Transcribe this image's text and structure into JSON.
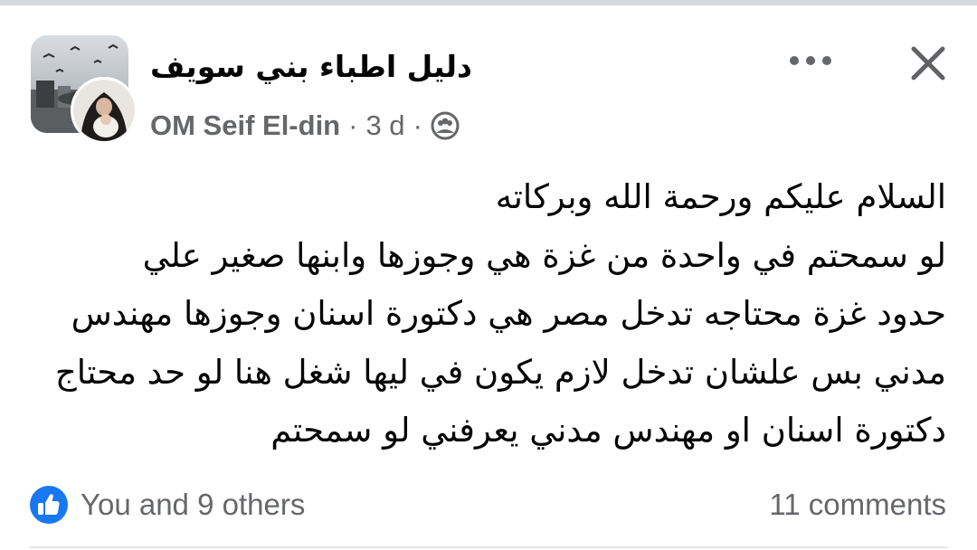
{
  "post": {
    "group_name": "دليل اطباء بني سويف",
    "author": "OM Seif El-din",
    "separator": "·",
    "time": "3 d",
    "privacy": "group-members-icon",
    "text_lines": [
      "السلام عليكم ورحمة الله وبركاته",
      "لو سمحتم في واحدة من غزة هي وجوزها  وابنها صغير علي",
      "حدود غزة محتاجه تدخل مصر هي دكتورة اسنان وجوزها مهندس",
      "مدني بس علشان تدخل لازم يكون في ليها شغل هنا لو حد محتاج",
      "دكتورة اسنان او مهندس مدني يعرفني لو سمحتم"
    ],
    "reactions_text": "You and 9 others",
    "comments_text": "11 comments"
  },
  "icons": {
    "more": "more-dots-icon",
    "close": "close-icon",
    "like": "like-thumb-icon"
  },
  "colors": {
    "primary_text": "#050505",
    "secondary_text": "#65676b",
    "like_blue": "#1877f2",
    "divider": "#e4e6eb"
  }
}
